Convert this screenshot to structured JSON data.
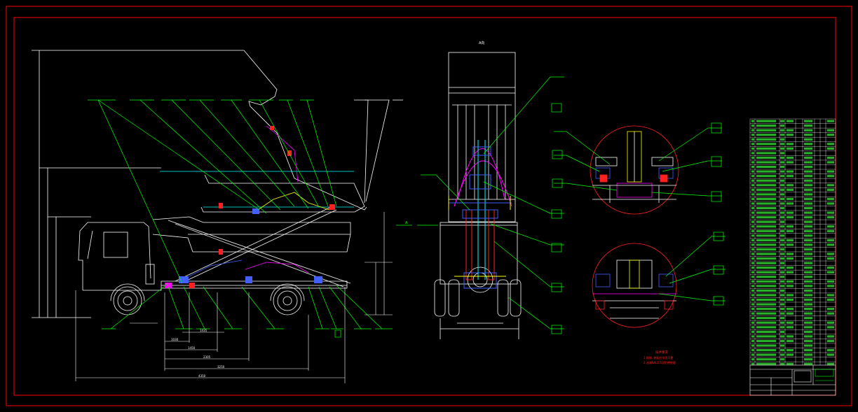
{
  "drawing": {
    "view_label_top": "A向",
    "view_label_a": "A",
    "dimensions": {
      "d1": "1435",
      "d2": "1030",
      "d3": "1450",
      "d4": "2305",
      "d5": "3250",
      "d6": "4350",
      "d7": "1770",
      "d8": "1345"
    },
    "notes": {
      "title": "技术要求",
      "line1": "1.焊接. 装配应牢固可靠",
      "line2": "2.油漆RAL1.6及防锈处理"
    }
  },
  "colors": {
    "frame": "#ff0000",
    "line": "#ffffff",
    "leader": "#00ff00",
    "cyan": "#00ffff",
    "magenta": "#ff00ff",
    "blue": "#4060ff",
    "yellow": "#ffff00",
    "red": "#ff2020"
  }
}
